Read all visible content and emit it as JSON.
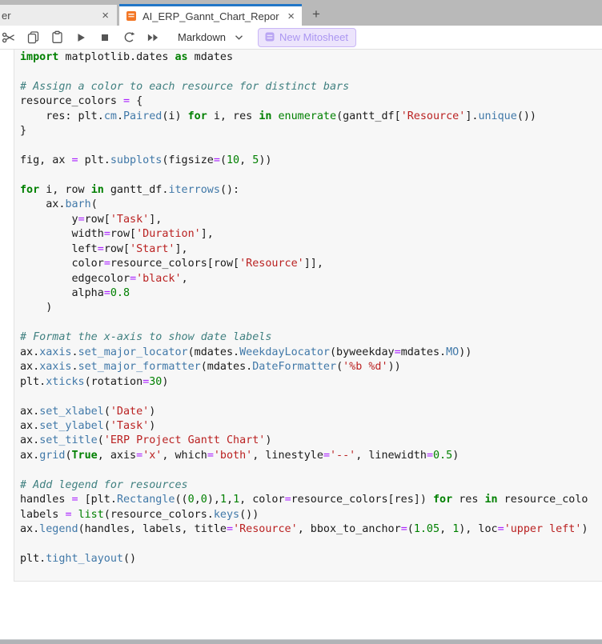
{
  "browser": {
    "tabs": [
      {
        "label": "er",
        "close": "×"
      },
      {
        "label": "AI_ERP_Gannt_Chart_Repor",
        "close": "×",
        "icon": "notebook-icon"
      }
    ],
    "new_tab_label": "+"
  },
  "toolbar": {
    "icon_names": [
      "cut-icon",
      "copy-icon",
      "paste-icon",
      "run-icon",
      "stop-icon",
      "restart-icon",
      "run-all-icon"
    ],
    "cell_type": "Markdown",
    "cell_type_chevron": "chevron-down-icon",
    "mitosheet_label": "New Mitosheet",
    "mitosheet_icon": "mitosheet-logo-icon"
  },
  "colors": {
    "accent_blue": "#2176c7",
    "tab_bar_gray": "#b9b9b9",
    "notebook_orange": "#f37726",
    "mito_purple_text": "#ab96f1",
    "mito_purple_bg": "#ece4fc",
    "mito_purple_border": "#c9b6f5",
    "cell_bg": "#f7f7f7",
    "keyword_green": "#008000",
    "string_red": "#ba2121",
    "comment_teal": "#408080",
    "operator_purple": "#aa22ff",
    "property_blue": "#4078a8"
  },
  "editor": {
    "lines": [
      [
        [
          "kw",
          "import"
        ],
        [
          "pl",
          " matplotlib.dates "
        ],
        [
          "kw",
          "as"
        ],
        [
          "pl",
          " mdates"
        ]
      ],
      [],
      [
        [
          "cm",
          "# Assign a color to each resource for distinct bars"
        ]
      ],
      [
        [
          "pl",
          "resource_colors "
        ],
        [
          "op",
          "="
        ],
        [
          "pl",
          " {"
        ]
      ],
      [
        [
          "pl",
          "    res: plt."
        ],
        [
          "pr",
          "cm"
        ],
        [
          "pl",
          "."
        ],
        [
          "pr",
          "Paired"
        ],
        [
          "pl",
          "(i) "
        ],
        [
          "kw",
          "for"
        ],
        [
          "pl",
          " i, res "
        ],
        [
          "kw",
          "in"
        ],
        [
          "pl",
          " "
        ],
        [
          "bi",
          "enumerate"
        ],
        [
          "pl",
          "(gantt_df["
        ],
        [
          "st",
          "'Resource'"
        ],
        [
          "pl",
          "]."
        ],
        [
          "pr",
          "unique"
        ],
        [
          "pl",
          "())"
        ]
      ],
      [
        [
          "pl",
          "}"
        ]
      ],
      [],
      [
        [
          "pl",
          "fig, ax "
        ],
        [
          "op",
          "="
        ],
        [
          "pl",
          " plt."
        ],
        [
          "pr",
          "subplots"
        ],
        [
          "pl",
          "(figsize"
        ],
        [
          "op",
          "="
        ],
        [
          "pl",
          "("
        ],
        [
          "nu",
          "10"
        ],
        [
          "pl",
          ", "
        ],
        [
          "nu",
          "5"
        ],
        [
          "pl",
          "))"
        ]
      ],
      [],
      [
        [
          "kw",
          "for"
        ],
        [
          "pl",
          " i, row "
        ],
        [
          "kw",
          "in"
        ],
        [
          "pl",
          " gantt_df."
        ],
        [
          "pr",
          "iterrows"
        ],
        [
          "pl",
          "():"
        ]
      ],
      [
        [
          "pl",
          "    ax."
        ],
        [
          "pr",
          "barh"
        ],
        [
          "pl",
          "("
        ]
      ],
      [
        [
          "pl",
          "        y"
        ],
        [
          "op",
          "="
        ],
        [
          "pl",
          "row["
        ],
        [
          "st",
          "'Task'"
        ],
        [
          "pl",
          "],"
        ]
      ],
      [
        [
          "pl",
          "        width"
        ],
        [
          "op",
          "="
        ],
        [
          "pl",
          "row["
        ],
        [
          "st",
          "'Duration'"
        ],
        [
          "pl",
          "],"
        ]
      ],
      [
        [
          "pl",
          "        left"
        ],
        [
          "op",
          "="
        ],
        [
          "pl",
          "row["
        ],
        [
          "st",
          "'Start'"
        ],
        [
          "pl",
          "],"
        ]
      ],
      [
        [
          "pl",
          "        color"
        ],
        [
          "op",
          "="
        ],
        [
          "pl",
          "resource_colors[row["
        ],
        [
          "st",
          "'Resource'"
        ],
        [
          "pl",
          "]],"
        ]
      ],
      [
        [
          "pl",
          "        edgecolor"
        ],
        [
          "op",
          "="
        ],
        [
          "st",
          "'black'"
        ],
        [
          "pl",
          ","
        ]
      ],
      [
        [
          "pl",
          "        alpha"
        ],
        [
          "op",
          "="
        ],
        [
          "nu",
          "0.8"
        ]
      ],
      [
        [
          "pl",
          "    )"
        ]
      ],
      [],
      [
        [
          "cm",
          "# Format the x-axis to show date labels"
        ]
      ],
      [
        [
          "pl",
          "ax."
        ],
        [
          "pr",
          "xaxis"
        ],
        [
          "pl",
          "."
        ],
        [
          "pr",
          "set_major_locator"
        ],
        [
          "pl",
          "(mdates."
        ],
        [
          "pr",
          "WeekdayLocator"
        ],
        [
          "pl",
          "(byweekday"
        ],
        [
          "op",
          "="
        ],
        [
          "pl",
          "mdates."
        ],
        [
          "pr",
          "MO"
        ],
        [
          "pl",
          "))"
        ]
      ],
      [
        [
          "pl",
          "ax."
        ],
        [
          "pr",
          "xaxis"
        ],
        [
          "pl",
          "."
        ],
        [
          "pr",
          "set_major_formatter"
        ],
        [
          "pl",
          "(mdates."
        ],
        [
          "pr",
          "DateFormatter"
        ],
        [
          "pl",
          "("
        ],
        [
          "st",
          "'%b %d'"
        ],
        [
          "pl",
          "))"
        ]
      ],
      [
        [
          "pl",
          "plt."
        ],
        [
          "pr",
          "xticks"
        ],
        [
          "pl",
          "(rotation"
        ],
        [
          "op",
          "="
        ],
        [
          "nu",
          "30"
        ],
        [
          "pl",
          ")"
        ]
      ],
      [],
      [
        [
          "pl",
          "ax."
        ],
        [
          "pr",
          "set_xlabel"
        ],
        [
          "pl",
          "("
        ],
        [
          "st",
          "'Date'"
        ],
        [
          "pl",
          ")"
        ]
      ],
      [
        [
          "pl",
          "ax."
        ],
        [
          "pr",
          "set_ylabel"
        ],
        [
          "pl",
          "("
        ],
        [
          "st",
          "'Task'"
        ],
        [
          "pl",
          ")"
        ]
      ],
      [
        [
          "pl",
          "ax."
        ],
        [
          "pr",
          "set_title"
        ],
        [
          "pl",
          "("
        ],
        [
          "st",
          "'ERP Project Gantt Chart'"
        ],
        [
          "pl",
          ")"
        ]
      ],
      [
        [
          "pl",
          "ax."
        ],
        [
          "pr",
          "grid"
        ],
        [
          "pl",
          "("
        ],
        [
          "kw",
          "True"
        ],
        [
          "pl",
          ", axis"
        ],
        [
          "op",
          "="
        ],
        [
          "st",
          "'x'"
        ],
        [
          "pl",
          ", which"
        ],
        [
          "op",
          "="
        ],
        [
          "st",
          "'both'"
        ],
        [
          "pl",
          ", linestyle"
        ],
        [
          "op",
          "="
        ],
        [
          "st",
          "'--'"
        ],
        [
          "pl",
          ", linewidth"
        ],
        [
          "op",
          "="
        ],
        [
          "nu",
          "0.5"
        ],
        [
          "pl",
          ")"
        ]
      ],
      [],
      [
        [
          "cm",
          "# Add legend for resources"
        ]
      ],
      [
        [
          "pl",
          "handles "
        ],
        [
          "op",
          "="
        ],
        [
          "pl",
          " [plt."
        ],
        [
          "pr",
          "Rectangle"
        ],
        [
          "pl",
          "(("
        ],
        [
          "nu",
          "0"
        ],
        [
          "pl",
          ","
        ],
        [
          "nu",
          "0"
        ],
        [
          "pl",
          "),"
        ],
        [
          "nu",
          "1"
        ],
        [
          "pl",
          ","
        ],
        [
          "nu",
          "1"
        ],
        [
          "pl",
          ", color"
        ],
        [
          "op",
          "="
        ],
        [
          "pl",
          "resource_colors[res]) "
        ],
        [
          "kw",
          "for"
        ],
        [
          "pl",
          " res "
        ],
        [
          "kw",
          "in"
        ],
        [
          "pl",
          " resource_colo"
        ]
      ],
      [
        [
          "pl",
          "labels "
        ],
        [
          "op",
          "="
        ],
        [
          "pl",
          " "
        ],
        [
          "bi",
          "list"
        ],
        [
          "pl",
          "(resource_colors."
        ],
        [
          "pr",
          "keys"
        ],
        [
          "pl",
          "())"
        ]
      ],
      [
        [
          "pl",
          "ax."
        ],
        [
          "pr",
          "legend"
        ],
        [
          "pl",
          "(handles, labels, title"
        ],
        [
          "op",
          "="
        ],
        [
          "st",
          "'Resource'"
        ],
        [
          "pl",
          ", bbox_to_anchor"
        ],
        [
          "op",
          "="
        ],
        [
          "pl",
          "("
        ],
        [
          "nu",
          "1.05"
        ],
        [
          "pl",
          ", "
        ],
        [
          "nu",
          "1"
        ],
        [
          "pl",
          "), loc"
        ],
        [
          "op",
          "="
        ],
        [
          "st",
          "'upper left'"
        ],
        [
          "pl",
          ")"
        ]
      ],
      [],
      [
        [
          "pl",
          "plt."
        ],
        [
          "pr",
          "tight_layout"
        ],
        [
          "pl",
          "()"
        ]
      ]
    ]
  }
}
